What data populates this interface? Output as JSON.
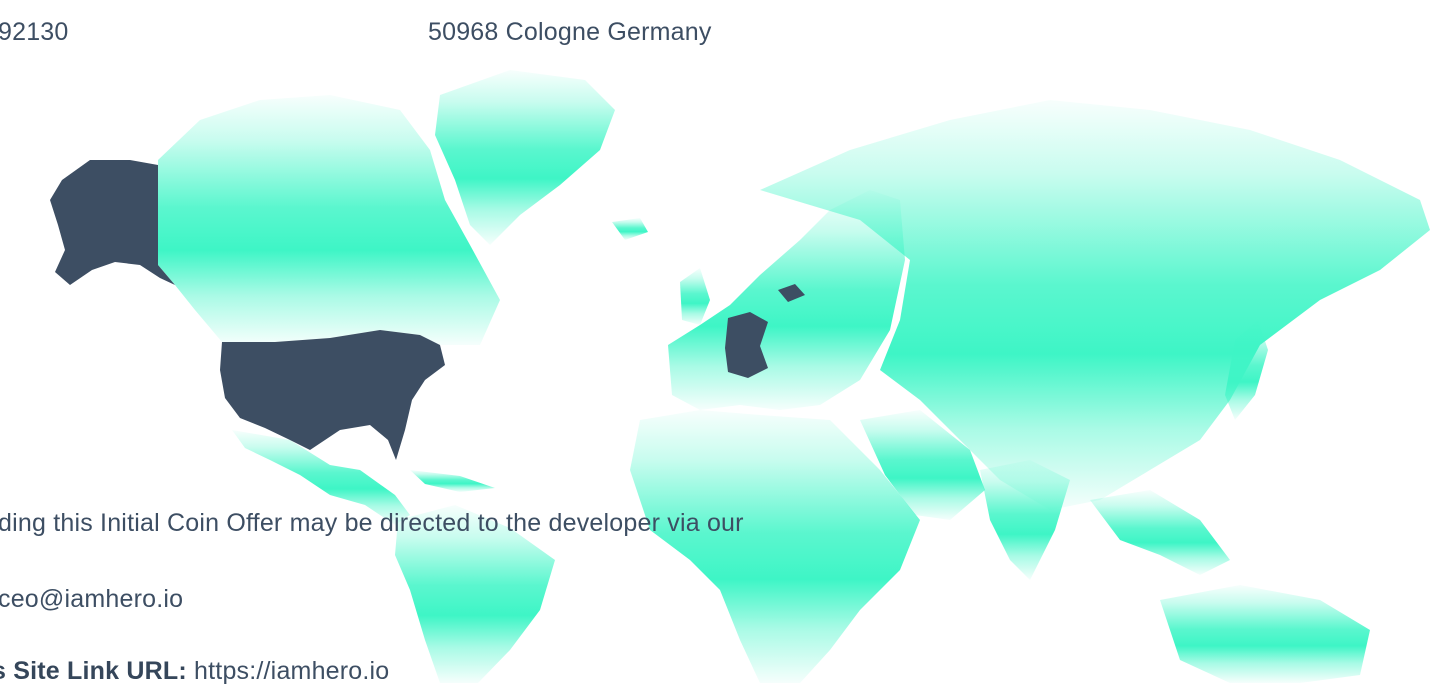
{
  "contact": {
    "phone_tail": "92130",
    "address_tail": "50968 Cologne Germany",
    "inquiry_sentence": "ding this Initial Coin Offer may be directed to the developer via our",
    "email_fragment": "ceo@iamhero.io",
    "site_label": "s Site Link URL:",
    "site_url": "https://iamhero.io"
  },
  "colors": {
    "map_land": "#3ef5c6",
    "highlight_country": "#3d4e63",
    "text": "#3d4e63"
  }
}
